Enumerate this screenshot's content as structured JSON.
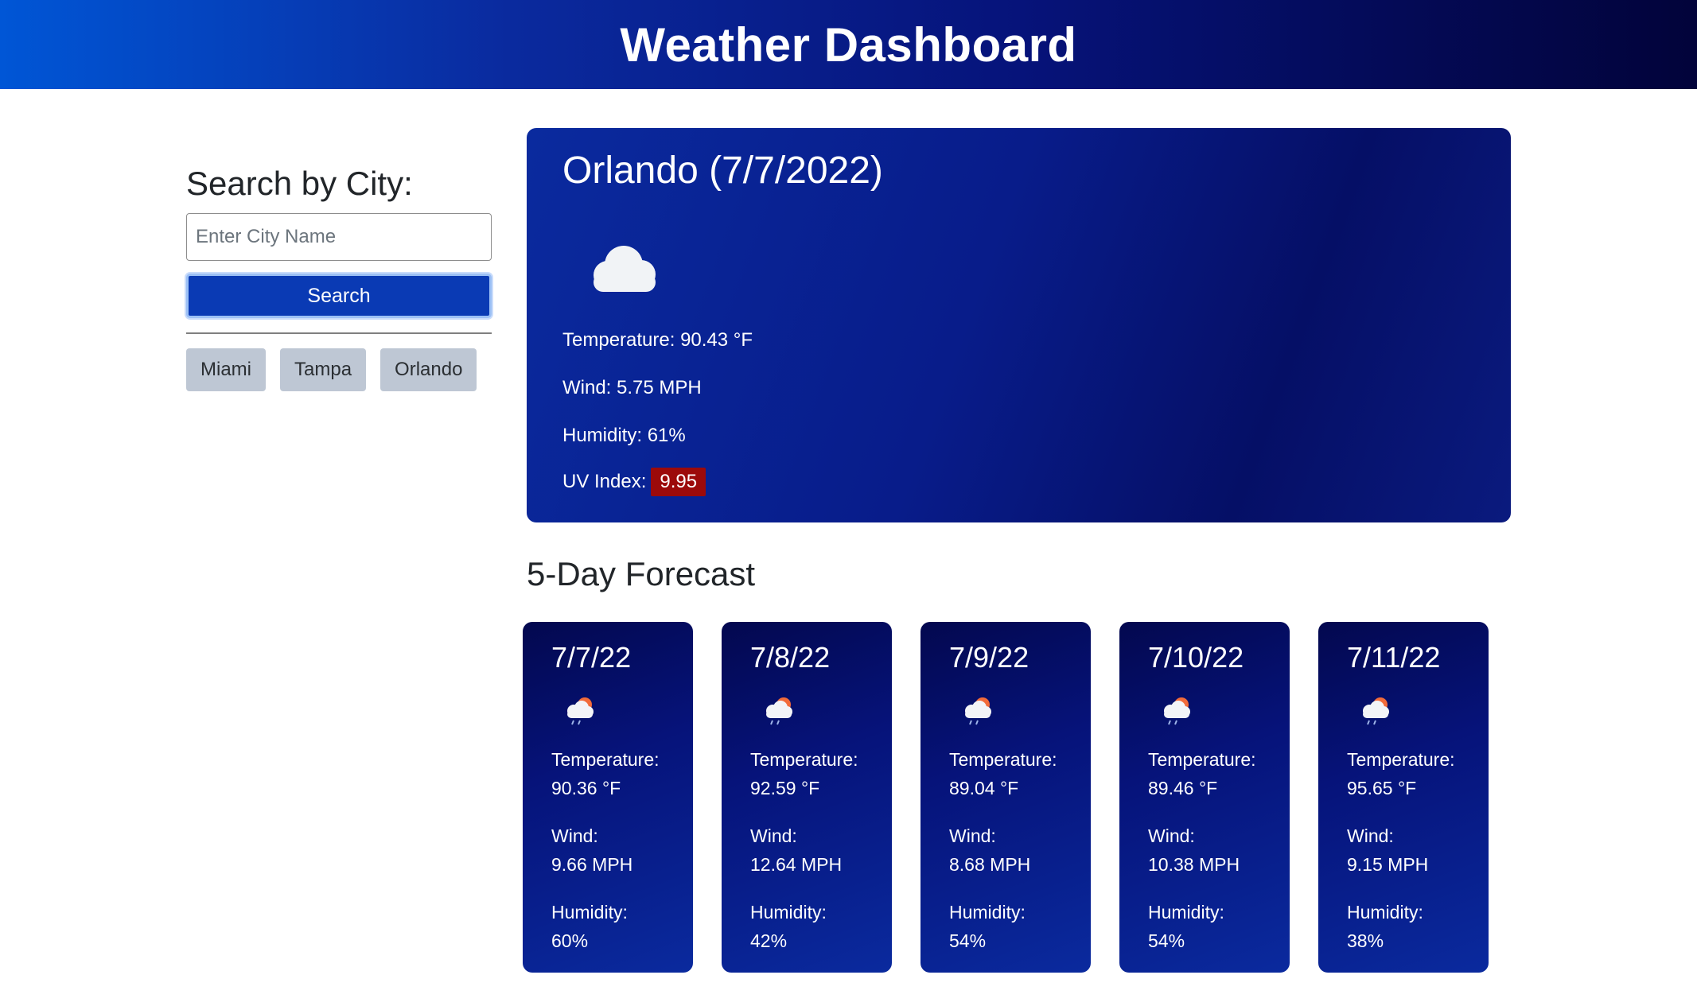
{
  "header": {
    "title": "Weather Dashboard"
  },
  "search": {
    "heading": "Search by City:",
    "placeholder": "Enter City Name",
    "button_label": "Search",
    "history": [
      "Miami",
      "Tampa",
      "Orlando"
    ]
  },
  "current": {
    "title": "Orlando (7/7/2022)",
    "icon": "cloud-icon",
    "temperature": "Temperature: 90.43 °F",
    "wind": "Wind: 5.75 MPH",
    "humidity": "Humidity: 61%",
    "uv_label": "UV Index:",
    "uv_value": "9.95",
    "uv_color": "#9c0a0a"
  },
  "forecast": {
    "heading": "5-Day Forecast",
    "days": [
      {
        "date": "7/7/22",
        "icon": "cloud-sun-rain-icon",
        "temp_label": "Temperature:",
        "temp": "90.36 °F",
        "wind_label": "Wind:",
        "wind": "9.66 MPH",
        "humidity_label": "Humidity:",
        "humidity": "60%"
      },
      {
        "date": "7/8/22",
        "icon": "cloud-sun-rain-icon",
        "temp_label": "Temperature:",
        "temp": "92.59 °F",
        "wind_label": "Wind:",
        "wind": "12.64 MPH",
        "humidity_label": "Humidity:",
        "humidity": "42%"
      },
      {
        "date": "7/9/22",
        "icon": "cloud-sun-rain-icon",
        "temp_label": "Temperature:",
        "temp": "89.04 °F",
        "wind_label": "Wind:",
        "wind": "8.68 MPH",
        "humidity_label": "Humidity:",
        "humidity": "54%"
      },
      {
        "date": "7/10/22",
        "icon": "cloud-sun-rain-icon",
        "temp_label": "Temperature:",
        "temp": "89.46 °F",
        "wind_label": "Wind:",
        "wind": "10.38 MPH",
        "humidity_label": "Humidity:",
        "humidity": "54%"
      },
      {
        "date": "7/11/22",
        "icon": "cloud-sun-rain-icon",
        "temp_label": "Temperature:",
        "temp": "95.65 °F",
        "wind_label": "Wind:",
        "wind": "9.15 MPH",
        "humidity_label": "Humidity:",
        "humidity": "38%"
      }
    ]
  }
}
